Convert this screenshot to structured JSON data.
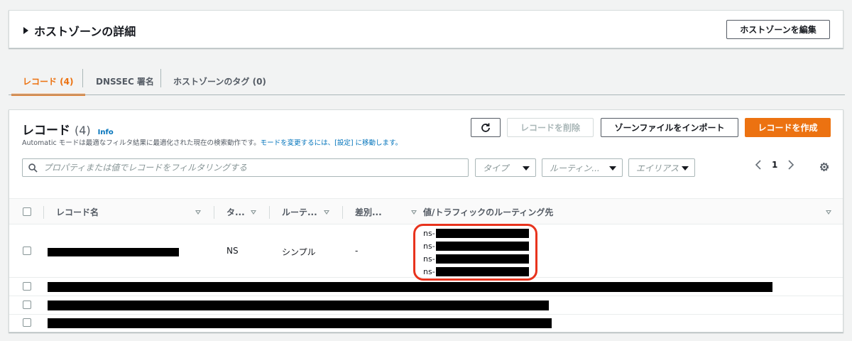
{
  "details": {
    "title": "ホストゾーンの詳細",
    "edit_button": "ホストゾーンを編集"
  },
  "tabs": [
    {
      "label": "レコード (4)",
      "active": true
    },
    {
      "label": "DNSSEC 署名",
      "active": false
    },
    {
      "label": "ホストゾーンのタグ (0)",
      "active": false
    }
  ],
  "records": {
    "title": "レコード",
    "count": "(4)",
    "info": "Info",
    "description_prefix": "Automatic モードは最適なフィルタ結果に最適化された現在の検索動作です。",
    "description_link": "モードを変更するには、[設定] に移動します。",
    "buttons": {
      "delete": "レコードを削除",
      "import": "ゾーンファイルをインポート",
      "create": "レコードを作成"
    },
    "search": {
      "placeholder": "プロパティまたは値でレコードをフィルタリングする"
    },
    "filters": {
      "type": "タイプ",
      "routing": "ルーティン...",
      "alias": "エイリアス"
    },
    "page": "1",
    "columns": [
      "レコード名",
      "タ...",
      "ルーテ...",
      "差別...",
      "値/トラフィックのルーティング先"
    ],
    "rows": [
      {
        "type": "NS",
        "routing": "シンプル",
        "differentiator": "-",
        "values": [
          "ns-",
          "ns-",
          "ns-",
          "ns-"
        ]
      },
      {
        "type": "",
        "routing": "",
        "differentiator": "",
        "values": []
      },
      {
        "type": "",
        "routing": "",
        "differentiator": "",
        "values": []
      },
      {
        "type": "",
        "routing": "",
        "differentiator": "",
        "values": []
      }
    ]
  },
  "colors": {
    "accent": "#ec7211",
    "link": "#0073bb",
    "highlight": "#e8331d"
  }
}
